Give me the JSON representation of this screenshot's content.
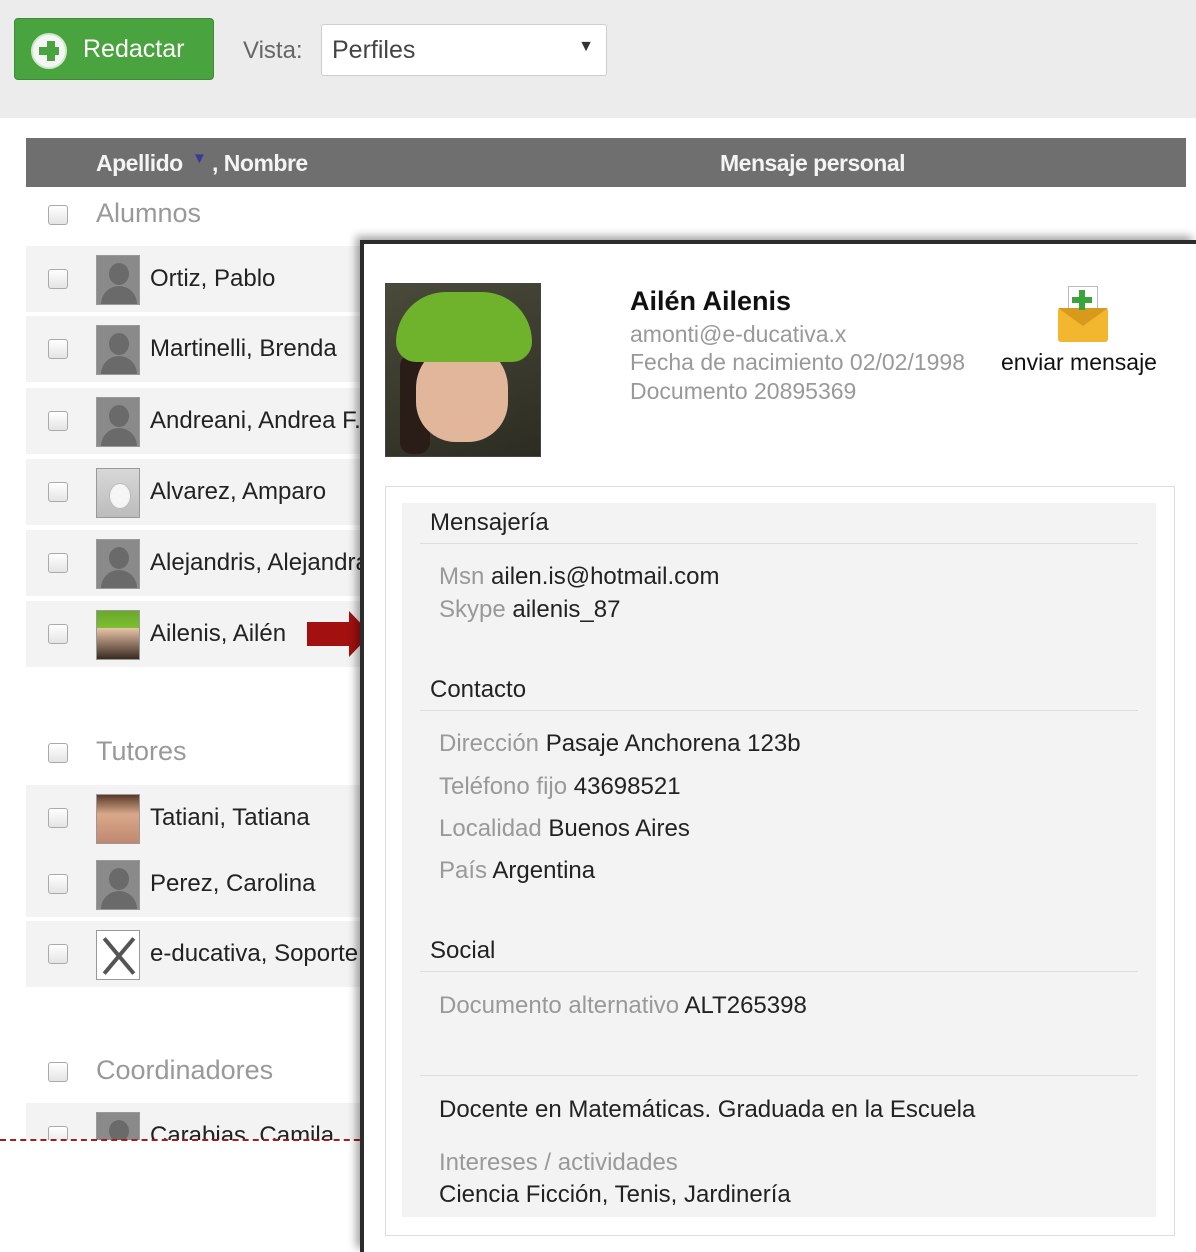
{
  "toolbar": {
    "compose_label": "Redactar",
    "vista_label": "Vista:",
    "vista_value": "Perfiles",
    "vista_arrow": "▼",
    "brand_color": "#49a33e"
  },
  "list": {
    "header": {
      "apellido": "Apellido",
      "sort_icon": "▼",
      "nombre": ", Nombre",
      "mensaje": "Mensaje personal"
    },
    "groups": [
      {
        "title": "Alumnos",
        "rows": [
          {
            "name": "Ortiz, Pablo",
            "avatar": "generic"
          },
          {
            "name": "Martinelli, Brenda",
            "avatar": "generic"
          },
          {
            "name": "Andreani, Andrea F.",
            "avatar": "generic"
          },
          {
            "name": "Alvarez, Amparo",
            "avatar": "bunny-photo"
          },
          {
            "name": "Alejandris, Alejandra",
            "avatar": "generic"
          },
          {
            "name": "Ailenis, Ailén",
            "avatar": "green-hat-photo"
          }
        ]
      },
      {
        "title": "Tutores",
        "rows": [
          {
            "name": "Tatiani, Tatiana",
            "avatar": "face-photo"
          },
          {
            "name": "Perez, Carolina",
            "avatar": "generic"
          },
          {
            "name": "e-ducativa, Soporte",
            "avatar": "tools"
          }
        ]
      },
      {
        "title": "Coordinadores",
        "rows": [
          {
            "name": "Carabias, Camila",
            "avatar": "generic"
          }
        ]
      }
    ]
  },
  "profile": {
    "name": "Ailén Ailenis",
    "email": "amonti@e-ducativa.x",
    "birth_label": "Fecha de nacimiento",
    "birth_value": "02/02/1998",
    "doc_label": "Documento",
    "doc_value": "20895369",
    "send_label": "enviar mensaje",
    "sections": {
      "mensajeria": {
        "title": "Mensajería",
        "msn_label": "Msn",
        "msn_value": "ailen.is@hotmail.com",
        "skype_label": "Skype",
        "skype_value": "ailenis_87"
      },
      "contacto": {
        "title": "Contacto",
        "direccion_label": "Dirección",
        "direccion_value": "Pasaje Anchorena 123b",
        "telefono_label": "Teléfono fijo",
        "telefono_value": "43698521",
        "localidad_label": "Localidad",
        "localidad_value": "Buenos Aires",
        "pais_label": "País",
        "pais_value": "Argentina"
      },
      "social": {
        "title": "Social",
        "docalt_label": "Documento alternativo",
        "docalt_value": "ALT265398"
      }
    },
    "bio": "Docente en Matemáticas. Graduada en la Escuela",
    "interests_label": "Intereses / actividades",
    "interests_value": "Ciencia Ficción, Tenis, Jardinería"
  }
}
